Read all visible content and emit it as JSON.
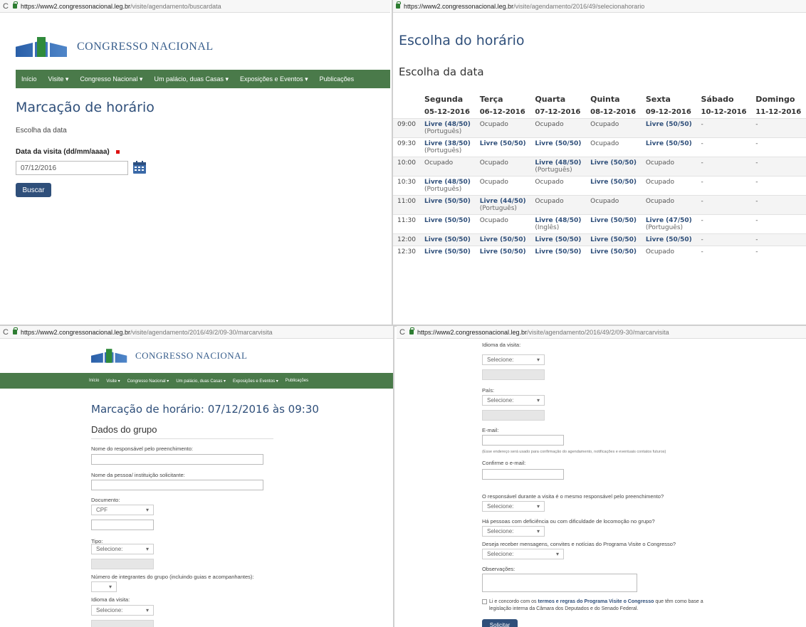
{
  "q1": {
    "url_host": "https://www2.congressonacional.leg.br",
    "url_path": "/visite/agendamento/buscardata",
    "logo_text": "CONGRESSO NACIONAL",
    "nav": [
      "Início",
      "Visite ▾",
      "Congresso Nacional ▾",
      "Um palácio, duas Casas ▾",
      "Exposições e Eventos ▾",
      "Publicações"
    ],
    "page_title": "Marcação de horário",
    "subtitle": "Escolha da data",
    "date_label": "Data da visita (dd/mm/aaaa)",
    "date_value": "07/12/2016",
    "search_button": "Buscar"
  },
  "q2": {
    "url_host": "https://www2.congressonacional.leg.br",
    "url_path": "/visite/agendamento/2016/49/selecionahorario",
    "page_title": "Escolha do horário",
    "subtitle": "Escolha da data",
    "days": [
      "Segunda",
      "Terça",
      "Quarta",
      "Quinta",
      "Sexta",
      "Sábado",
      "Domingo"
    ],
    "dates": [
      "05-12-2016",
      "06-12-2016",
      "07-12-2016",
      "08-12-2016",
      "09-12-2016",
      "10-12-2016",
      "11-12-2016"
    ],
    "rows": [
      {
        "time": "09:00",
        "cells": [
          {
            "t": "Livre (48/50)",
            "free": true,
            "lang": "(Português)"
          },
          {
            "t": "Ocupado"
          },
          {
            "t": "Ocupado"
          },
          {
            "t": "Ocupado"
          },
          {
            "t": "Livre (50/50)",
            "free": true
          },
          {
            "t": "-"
          },
          {
            "t": "-"
          }
        ]
      },
      {
        "time": "09:30",
        "cells": [
          {
            "t": "Livre (38/50)",
            "free": true,
            "lang": "(Português)"
          },
          {
            "t": "Livre (50/50)",
            "free": true
          },
          {
            "t": "Livre (50/50)",
            "free": true
          },
          {
            "t": "Ocupado"
          },
          {
            "t": "Livre (50/50)",
            "free": true
          },
          {
            "t": "-"
          },
          {
            "t": "-"
          }
        ]
      },
      {
        "time": "10:00",
        "cells": [
          {
            "t": "Ocupado"
          },
          {
            "t": "Ocupado"
          },
          {
            "t": "Livre (48/50)",
            "free": true,
            "lang": "(Português)"
          },
          {
            "t": "Livre (50/50)",
            "free": true
          },
          {
            "t": "Ocupado"
          },
          {
            "t": "-"
          },
          {
            "t": "-"
          }
        ]
      },
      {
        "time": "10:30",
        "cells": [
          {
            "t": "Livre (48/50)",
            "free": true,
            "lang": "(Português)"
          },
          {
            "t": "Ocupado"
          },
          {
            "t": "Ocupado"
          },
          {
            "t": "Livre (50/50)",
            "free": true
          },
          {
            "t": "Ocupado"
          },
          {
            "t": "-"
          },
          {
            "t": "-"
          }
        ]
      },
      {
        "time": "11:00",
        "cells": [
          {
            "t": "Livre (50/50)",
            "free": true
          },
          {
            "t": "Livre (44/50)",
            "free": true,
            "lang": "(Português)"
          },
          {
            "t": "Ocupado"
          },
          {
            "t": "Ocupado"
          },
          {
            "t": "Ocupado"
          },
          {
            "t": "-"
          },
          {
            "t": "-"
          }
        ]
      },
      {
        "time": "11:30",
        "cells": [
          {
            "t": "Livre (50/50)",
            "free": true
          },
          {
            "t": "Ocupado"
          },
          {
            "t": "Livre (48/50)",
            "free": true,
            "lang": "(Inglês)"
          },
          {
            "t": "Livre (50/50)",
            "free": true
          },
          {
            "t": "Livre (47/50)",
            "free": true,
            "lang": "(Português)"
          },
          {
            "t": "-"
          },
          {
            "t": "-"
          }
        ]
      },
      {
        "time": "12:00",
        "cells": [
          {
            "t": "Livre (50/50)",
            "free": true
          },
          {
            "t": "Livre (50/50)",
            "free": true
          },
          {
            "t": "Livre (50/50)",
            "free": true
          },
          {
            "t": "Livre (50/50)",
            "free": true
          },
          {
            "t": "Livre (50/50)",
            "free": true
          },
          {
            "t": "-"
          },
          {
            "t": "-"
          }
        ]
      },
      {
        "time": "12:30",
        "cells": [
          {
            "t": "Livre (50/50)",
            "free": true
          },
          {
            "t": "Livre (50/50)",
            "free": true
          },
          {
            "t": "Livre (50/50)",
            "free": true
          },
          {
            "t": "Livre (50/50)",
            "free": true
          },
          {
            "t": "Ocupado"
          },
          {
            "t": "-"
          },
          {
            "t": "-"
          }
        ]
      }
    ]
  },
  "q3": {
    "url_host": "https://www2.congressonacional.leg.br",
    "url_path": "/visite/agendamento/2016/49/2/09-30/marcarvisita",
    "logo_text": "CONGRESSO NACIONAL",
    "nav": [
      "Início",
      "Visite ▾",
      "Congresso Nacional ▾",
      "Um palácio, duas Casas ▾",
      "Exposições e Eventos ▾",
      "Publicações"
    ],
    "page_title": "Marcação de horário: 07/12/2016 às 09:30",
    "section": "Dados do grupo",
    "label_responsavel": "Nome do responsável pelo preenchimento:",
    "label_pessoa": "Nome da pessoa/ instituição solicitante:",
    "label_documento": "Documento:",
    "documento_value": "CPF",
    "label_tipo": "Tipo:",
    "tipo_value": "Selecione:",
    "label_integrantes": "Número de integrantes do grupo (incluindo guias e acompanhantes):",
    "label_idioma": "Idioma da visita:",
    "idioma_value": "Selecione:"
  },
  "q4": {
    "url_host": "https://www2.congressonacional.leg.br",
    "url_path": "/visite/agendamento/2016/49/2/09-30/marcarvisita",
    "label_idioma": "Idioma da visita:",
    "idioma_value": "Selecione:",
    "label_pais": "País:",
    "pais_value": "Selecione:",
    "label_email": "E-mail:",
    "email_note": "(Esse endereço será usado para confirmação do agendamento, notificações e eventuais contatos futuros)",
    "label_confirm": "Confirme o e-mail:",
    "q_responsavel": "O responsável durante a visita é o mesmo responsável pelo preenchimento?",
    "q_responsavel_value": "Selecione:",
    "q_deficiencia": "Há pessoas com deficiência ou com dificuldade de locomoção no grupo?",
    "q_deficiencia_value": "Selecione:",
    "q_mensagens": "Deseja receber mensagens, convites e notícias do Programa Visite o Congresso?",
    "q_mensagens_value": "Selecione:",
    "label_obs": "Observações:",
    "terms_pre": "Li e concordo com os",
    "terms_link": "termos e regras do Programa Visite o Congresso",
    "terms_post": "que têm como base a legislação interna da Câmara dos Deputados e do Senado Federal.",
    "submit": "Solicitar"
  }
}
